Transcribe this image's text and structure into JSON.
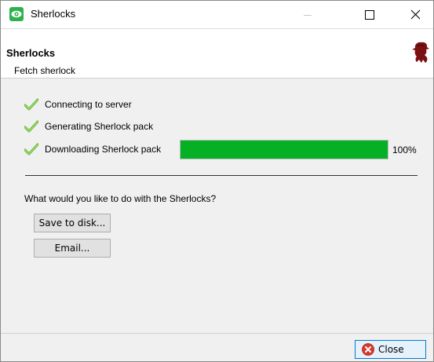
{
  "window": {
    "title": "Sherlocks",
    "controls": [
      "minimize",
      "maximize",
      "close"
    ]
  },
  "header": {
    "title": "Sherlocks",
    "subtitle": "Fetch sherlock"
  },
  "steps": [
    {
      "label": "Connecting to server",
      "icon": "check-icon"
    },
    {
      "label": "Generating Sherlock pack",
      "icon": "check-icon"
    },
    {
      "label": "Downloading Sherlock pack",
      "icon": "check-icon"
    }
  ],
  "progress": {
    "value": 100,
    "text": "100%",
    "fill_color": "#06b025"
  },
  "question": "What would you like to do with the Sherlocks?",
  "actions": {
    "save_label": "Save to disk...",
    "email_label": "Email..."
  },
  "footer": {
    "close_label": "Close"
  },
  "colors": {
    "accent": "#0078d7",
    "app_icon": "#2bb24c",
    "check": "#5cb82a",
    "logo": "#7a1010",
    "close_icon": "#d9382c"
  }
}
